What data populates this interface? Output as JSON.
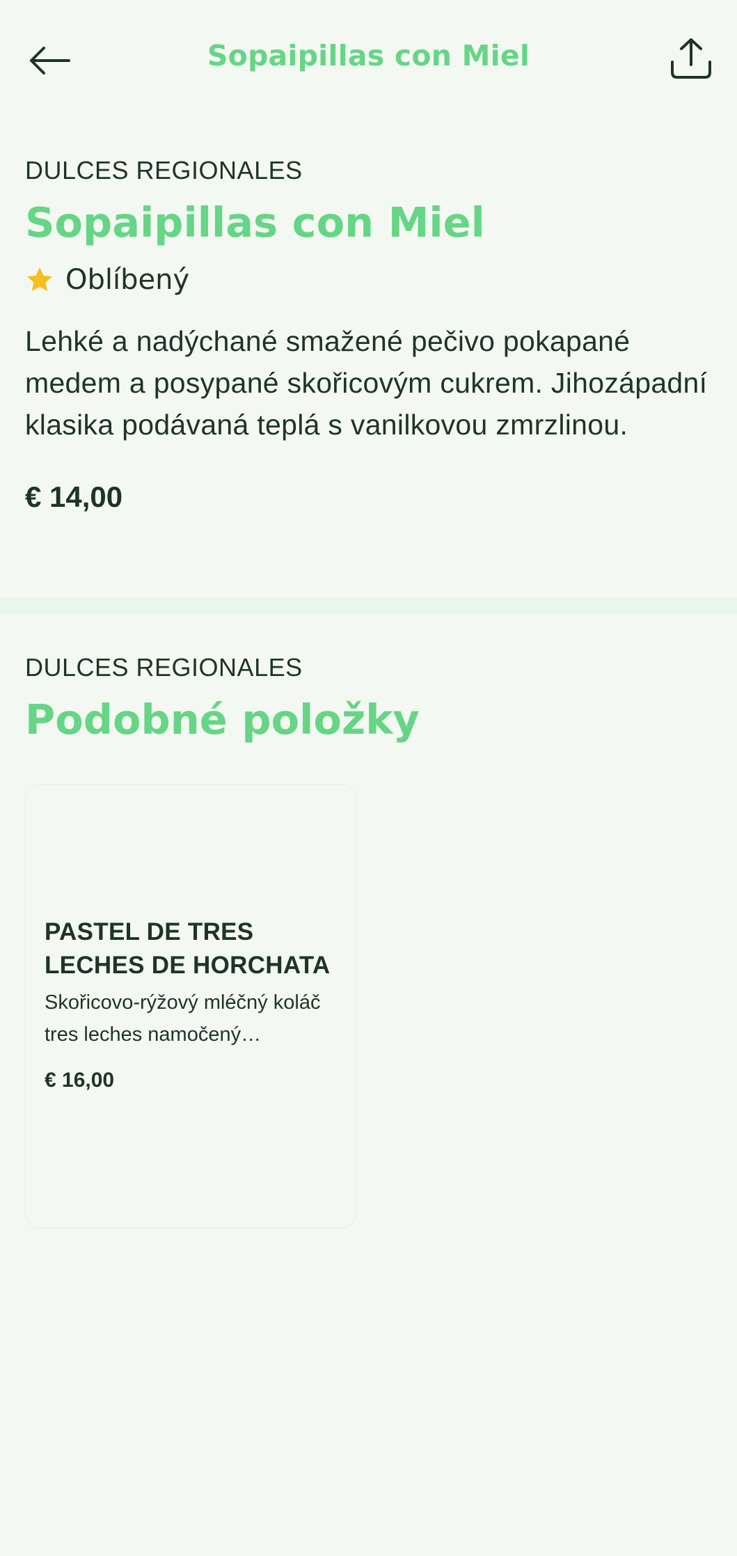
{
  "header": {
    "title": "Sopaipillas con Miel",
    "back_icon": "arrow-left-icon",
    "share_icon": "share-icon"
  },
  "detail": {
    "category": "DULCES REGIONALES",
    "title": "Sopaipillas con Miel",
    "favorite_label": "Oblíbený",
    "favorite_icon": "star-icon",
    "description": "Lehké a nadýchané smažené pečivo pokapané medem a posypané skořicovým cukrem. Jihozápadní klasika podávaná teplá s vanilkovou zmrzlinou.",
    "price": "€ 14,00"
  },
  "similar": {
    "category": "DULCES REGIONALES",
    "title": "Podobné položky",
    "items": [
      {
        "name": "PASTEL DE TRES LECHES DE HORCHATA",
        "description": "Skořicovo-rýžový mléčný koláč tres leches namočený…",
        "price": "€ 16,00"
      }
    ]
  },
  "colors": {
    "background": "#f3f8f2",
    "accent": "#66d585",
    "text": "#1f3424",
    "star": "#f5bf1f"
  }
}
